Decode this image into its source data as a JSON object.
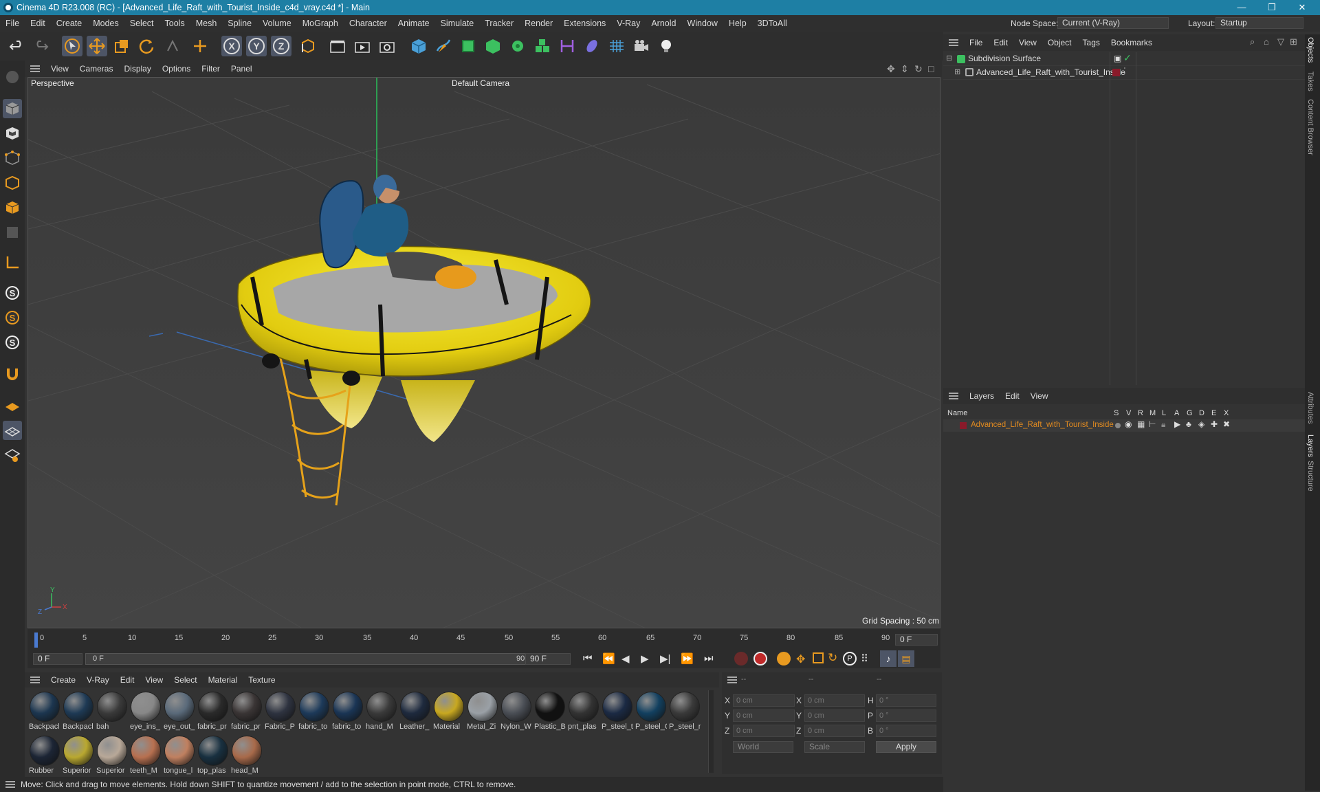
{
  "window": {
    "title": "Cinema 4D R23.008 (RC) - [Advanced_Life_Raft_with_Tourist_Inside_c4d_vray.c4d *] - Main"
  },
  "menubar": {
    "items": [
      "File",
      "Edit",
      "Create",
      "Modes",
      "Select",
      "Tools",
      "Mesh",
      "Spline",
      "Volume",
      "MoGraph",
      "Character",
      "Animate",
      "Simulate",
      "Tracker",
      "Render",
      "Extensions",
      "V-Ray",
      "Arnold",
      "Window",
      "Help",
      "3DToAll"
    ],
    "node_space_label": "Node Space:",
    "node_space_value": "Current (V-Ray)",
    "layout_label": "Layout:",
    "layout_value": "Startup"
  },
  "toolbar": {
    "axis_x": "X",
    "axis_y": "Y",
    "axis_z": "Z"
  },
  "viewport": {
    "menu": [
      "View",
      "Cameras",
      "Display",
      "Options",
      "Filter",
      "Panel"
    ],
    "name": "Perspective",
    "camera": "Default Camera",
    "grid_spacing": "Grid Spacing : 50 cm",
    "axis_labels": {
      "x": "X",
      "y": "Y",
      "z": "Z"
    }
  },
  "timeline": {
    "ticks": [
      "0",
      "5",
      "10",
      "15",
      "20",
      "25",
      "30",
      "35",
      "40",
      "45",
      "50",
      "55",
      "60",
      "65",
      "70",
      "75",
      "80",
      "85",
      "90"
    ],
    "current_frame": "0 F"
  },
  "transport": {
    "start": "0 F",
    "range_start": "0 F",
    "range_end": "90 F",
    "end": "90 F"
  },
  "materials": {
    "menu": [
      "Create",
      "V-Ray",
      "Edit",
      "View",
      "Select",
      "Material",
      "Texture"
    ],
    "items": [
      {
        "label": "Backpacl",
        "color": "#1c3650"
      },
      {
        "label": "Backpacl",
        "color": "#1e3a55"
      },
      {
        "label": "bah",
        "color": "#3a3a3a"
      },
      {
        "label": "eye_ins_",
        "color": "#888"
      },
      {
        "label": "eye_out_",
        "color": "#5a6a7a"
      },
      {
        "label": "fabric_pr",
        "color": "#2a2a2a"
      },
      {
        "label": "fabric_pr",
        "color": "#3a3535"
      },
      {
        "label": "Fabric_P",
        "color": "#2e3340"
      },
      {
        "label": "fabric_to",
        "color": "#1d3a5a"
      },
      {
        "label": "fabric_to",
        "color": "#1a3555"
      },
      {
        "label": "hand_M",
        "color": "#3a3a3a"
      },
      {
        "label": "Leather_",
        "color": "#1e2a3e"
      },
      {
        "label": "Material",
        "color": "#c8a820"
      },
      {
        "label": "Metal_Zi",
        "color": "#9aa0a6"
      },
      {
        "label": "Nylon_W",
        "color": "#4a4e55"
      },
      {
        "label": "Plastic_B",
        "color": "#111"
      },
      {
        "label": "pnt_plas",
        "color": "#333"
      },
      {
        "label": "P_steel_t",
        "color": "#1b2a44"
      },
      {
        "label": "P_steel_C",
        "color": "#124060"
      },
      {
        "label": "P_steel_r",
        "color": "#3a3a3a"
      },
      {
        "label": "Rubber",
        "color": "#1c2535"
      },
      {
        "label": "Superior",
        "color": "#b9a830"
      },
      {
        "label": "Superior",
        "color": "#b8a898"
      },
      {
        "label": "teeth_M",
        "color": "#b77050"
      },
      {
        "label": "tongue_l",
        "color": "#c08060"
      },
      {
        "label": "top_plas",
        "color": "#183040"
      },
      {
        "label": "head_M",
        "color": "#a86a4a"
      }
    ]
  },
  "coords": {
    "header": [
      "--",
      "--",
      "--"
    ],
    "rows": [
      {
        "a": "X",
        "av": "0 cm",
        "b": "X",
        "bv": "0 cm",
        "c": "H",
        "cv": "0 °"
      },
      {
        "a": "Y",
        "av": "0 cm",
        "b": "Y",
        "bv": "0 cm",
        "c": "P",
        "cv": "0 °"
      },
      {
        "a": "Z",
        "av": "0 cm",
        "b": "Z",
        "bv": "0 cm",
        "c": "B",
        "cv": "0 °"
      }
    ],
    "space": "World",
    "mode": "Scale",
    "apply": "Apply"
  },
  "objects": {
    "menu": [
      "File",
      "Edit",
      "View",
      "Object",
      "Tags",
      "Bookmarks"
    ],
    "items": [
      {
        "name": "Subdivision Surface"
      },
      {
        "name": "Advanced_Life_Raft_with_Tourist_Inside"
      }
    ]
  },
  "layers": {
    "menu": [
      "Layers",
      "Edit",
      "View"
    ],
    "columns": [
      "Name",
      "S",
      "V",
      "R",
      "M",
      "L",
      "A",
      "G",
      "D",
      "E",
      "X"
    ],
    "items": [
      {
        "name": "Advanced_Life_Raft_with_Tourist_Inside",
        "color": "#8a1a2a"
      }
    ]
  },
  "right_tabs": [
    "Objects",
    "Takes",
    "Content Browser",
    "Attributes",
    "Layers",
    "Structure"
  ],
  "status": "Move: Click and drag to move elements. Hold down SHIFT to quantize movement / add to the selection in point mode, CTRL to remove.",
  "colors": {
    "accent": "#1e7fa4",
    "raft_yellow": "#e6d21c",
    "layer_text": "#e08a20"
  }
}
